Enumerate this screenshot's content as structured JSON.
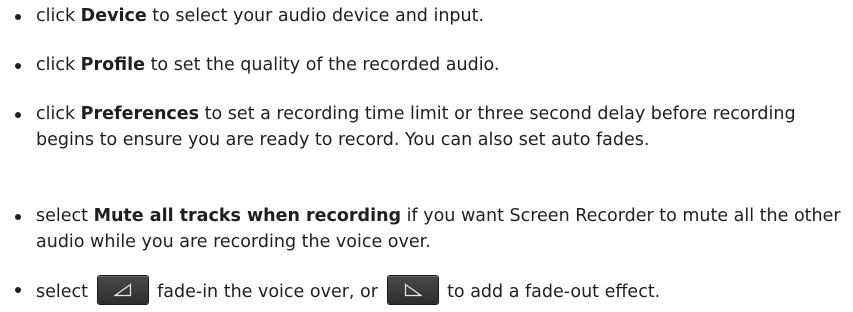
{
  "items": [
    {
      "pre": "click ",
      "bold": "Device",
      "post": " to select your audio device and input."
    },
    {
      "pre": "click ",
      "bold": "Profile",
      "post": " to set the quality of the recorded audio."
    },
    {
      "pre": "click ",
      "bold": "Preferences",
      "post": " to set a recording time limit or three second delay before recording begins to ensure you are ready to record. You can also set auto fades."
    },
    {
      "pre": "select ",
      "bold": "Mute all tracks when recording",
      "post": " if you want Screen Recorder to mute all the other audio while you are recording the voice over."
    },
    {
      "pre": "select ",
      "mid": " fade-in the voice over, or ",
      "post": " to add a fade-out effect.",
      "fade_in_icon": "fade-in-icon",
      "fade_out_icon": "fade-out-icon"
    }
  ],
  "colors": {
    "text": "#1f1f1f",
    "button_bg": "#3a3a3a",
    "icon_stroke": "#e6e6e6"
  }
}
